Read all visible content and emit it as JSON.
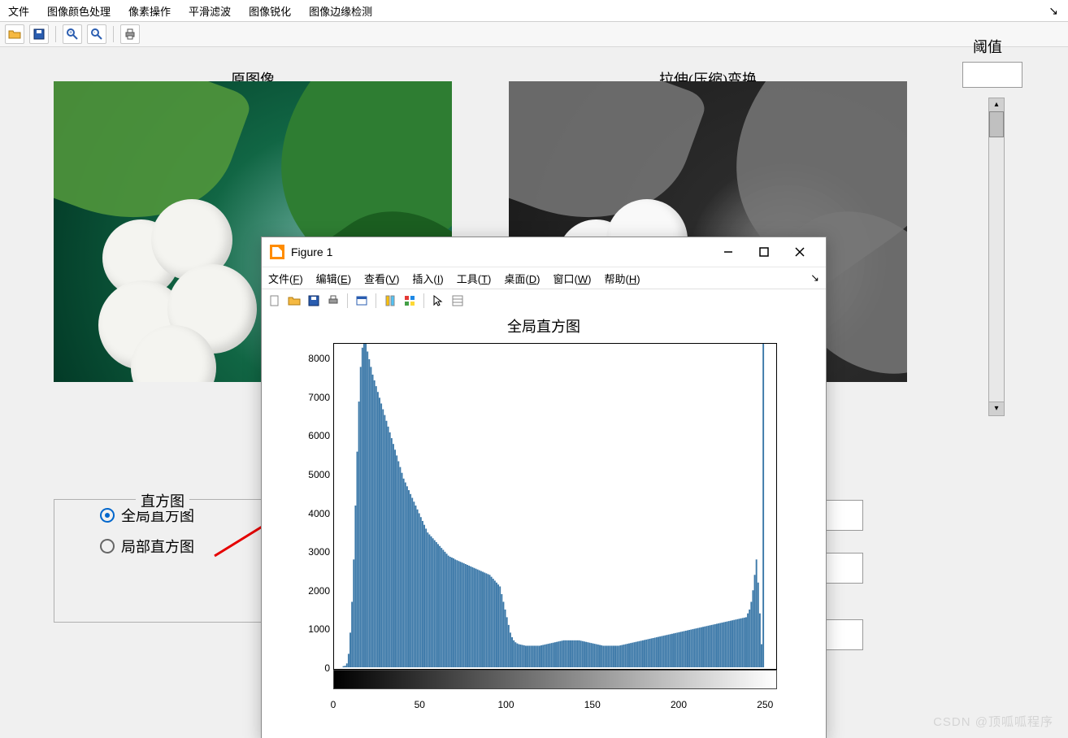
{
  "menubar": {
    "items": [
      "文件",
      "图像颜色处理",
      "像素操作",
      "平滑滤波",
      "图像锐化",
      "图像边缘检测"
    ]
  },
  "toolbar_icons": [
    "open-folder-icon",
    "save-icon",
    "zoom-in-icon",
    "zoom-out-icon",
    "print-icon"
  ],
  "panels": {
    "orig_title": "原图像",
    "trans_title": "拉伸(压缩)变换",
    "threshold_label": "阈值",
    "threshold_value": "",
    "hist_legend": "直方图",
    "radio_global": "全局直方图",
    "radio_local": "局部直方图"
  },
  "figure_window": {
    "title": "Figure 1",
    "menubar": [
      {
        "label": "文件",
        "mnemonic": "F"
      },
      {
        "label": "编辑",
        "mnemonic": "E"
      },
      {
        "label": "查看",
        "mnemonic": "V"
      },
      {
        "label": "插入",
        "mnemonic": "I"
      },
      {
        "label": "工具",
        "mnemonic": "T"
      },
      {
        "label": "桌面",
        "mnemonic": "D"
      },
      {
        "label": "窗口",
        "mnemonic": "W"
      },
      {
        "label": "帮助",
        "mnemonic": "H"
      }
    ],
    "toolbar_icons": [
      "new-icon",
      "open-folder-icon",
      "save-icon",
      "print-icon",
      "link-icon",
      "dock-icon",
      "colorbar-icon",
      "pointer-icon",
      "properties-icon"
    ],
    "plot_title": "全局直方图"
  },
  "chart_data": {
    "type": "bar",
    "title": "全局直方图",
    "xlabel": "",
    "ylabel": "",
    "xlim": [
      0,
      256
    ],
    "ylim": [
      0,
      8400
    ],
    "x_ticks": [
      0,
      50,
      100,
      150,
      200,
      250
    ],
    "y_ticks": [
      0,
      1000,
      2000,
      3000,
      4000,
      5000,
      6000,
      7000,
      8000
    ],
    "categories_note": "x represents intensity bins 0-255",
    "values": [
      0,
      0,
      0,
      0,
      0,
      30,
      40,
      100,
      350,
      900,
      1700,
      2800,
      4200,
      5600,
      6900,
      7800,
      8300,
      8400,
      8400,
      8200,
      8000,
      7800,
      7600,
      7450,
      7300,
      7150,
      7000,
      6850,
      6700,
      6550,
      6400,
      6250,
      6100,
      5950,
      5800,
      5650,
      5500,
      5350,
      5200,
      5050,
      4900,
      4800,
      4700,
      4600,
      4500,
      4400,
      4300,
      4200,
      4100,
      4000,
      3900,
      3800,
      3700,
      3600,
      3500,
      3450,
      3400,
      3350,
      3300,
      3250,
      3200,
      3150,
      3100,
      3050,
      3000,
      2950,
      2900,
      2870,
      2850,
      2830,
      2800,
      2780,
      2760,
      2740,
      2720,
      2700,
      2680,
      2660,
      2640,
      2620,
      2600,
      2580,
      2560,
      2540,
      2520,
      2500,
      2480,
      2460,
      2440,
      2420,
      2400,
      2350,
      2300,
      2250,
      2200,
      2150,
      2100,
      1900,
      1700,
      1500,
      1300,
      1100,
      900,
      780,
      700,
      650,
      620,
      600,
      590,
      580,
      570,
      560,
      560,
      560,
      560,
      560,
      560,
      560,
      560,
      560,
      570,
      580,
      590,
      600,
      610,
      620,
      630,
      640,
      650,
      660,
      670,
      680,
      690,
      700,
      700,
      700,
      700,
      700,
      700,
      700,
      700,
      700,
      700,
      690,
      680,
      670,
      660,
      650,
      640,
      630,
      620,
      610,
      600,
      590,
      580,
      570,
      560,
      560,
      560,
      560,
      560,
      560,
      560,
      560,
      560,
      560,
      570,
      580,
      590,
      600,
      610,
      620,
      630,
      640,
      650,
      660,
      670,
      680,
      690,
      700,
      710,
      720,
      730,
      740,
      750,
      760,
      770,
      780,
      790,
      800,
      810,
      820,
      830,
      840,
      850,
      860,
      870,
      880,
      890,
      900,
      910,
      920,
      930,
      940,
      950,
      960,
      970,
      980,
      990,
      1000,
      1010,
      1020,
      1030,
      1040,
      1050,
      1060,
      1070,
      1080,
      1090,
      1100,
      1110,
      1120,
      1130,
      1140,
      1150,
      1160,
      1170,
      1180,
      1190,
      1200,
      1210,
      1220,
      1230,
      1240,
      1250,
      1260,
      1270,
      1280,
      1290,
      1300,
      1400,
      1500,
      1700,
      2000,
      2400,
      2800,
      2200,
      1400,
      600,
      8400,
      0
    ]
  },
  "watermark": "CSDN @顶呱呱程序"
}
